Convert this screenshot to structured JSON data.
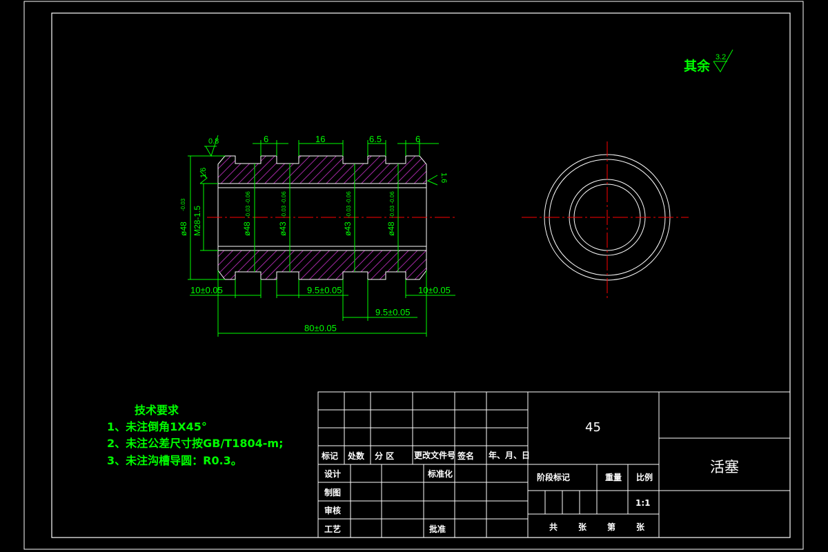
{
  "roughness": {
    "label": "其余",
    "value": "3.2"
  },
  "local_roughness": {
    "top": "0.8",
    "left": "1.6",
    "right": "1.6"
  },
  "dims": {
    "top_6a": "6",
    "top_16": "16",
    "top_65": "6.5",
    "top_6b": "6",
    "d48_outer": "ø48",
    "d48_outer_tol": "-0.03",
    "m28": "M28-1.5",
    "d48_a": "ø48",
    "d48_a_tol": "-0.03 -0.06",
    "d43_a": "ø43",
    "d43_a_tol": "-0.03 -0.06",
    "d43_b": "ø43",
    "d43_b_tol": "-0.03 -0.06",
    "d48_b": "ø48",
    "d48_b_tol": "-0.03 -0.06",
    "bot_left": "10±0.05",
    "bot_mid": "9.5±0.05",
    "bot_right": "10±0.05",
    "bot_lower": "9.5±0.05",
    "total": "80±0.05"
  },
  "tech": {
    "title": "技术要求",
    "items": [
      "1、未注倒角1X45°",
      "2、未注公差尺寸按GB/T1804-m;",
      "3、未注沟槽导圆：R0.3。"
    ]
  },
  "title_block": {
    "material": "45",
    "part_name": "活塞",
    "rev_headers": [
      "标记",
      "处数",
      "分 区",
      "更改文件号",
      "签名",
      "年、月、日"
    ],
    "design": "设计",
    "standard": "标准化",
    "draw": "制图",
    "check": "审核",
    "process": "工艺",
    "approve": "批准",
    "stage": "阶段标记",
    "weight": "重量",
    "scale_label": "比例",
    "scale": "1:1",
    "sheets": [
      "共",
      "张",
      "第",
      "张"
    ]
  }
}
